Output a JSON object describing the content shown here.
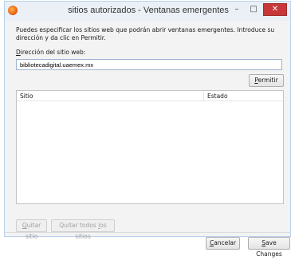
{
  "window": {
    "title": "sitios autorizados - Ventanas emergentes",
    "controls": {
      "minimize": "–",
      "maximize": "□",
      "close": "✕"
    }
  },
  "description": "Puedes especificar los sitios web que podrán abrir ventanas emergentes. Introduce su dirección y da clic en Permitir.",
  "url_field": {
    "label": "Dirección del sitio web:",
    "value": "bibliotecadigital.uaemex.mx"
  },
  "buttons": {
    "permit": "Permitir",
    "remove_site": "Quitar sitio",
    "remove_all": "Quitar todos los sitios",
    "cancel": "Cancelar",
    "save": "Save Changes"
  },
  "list": {
    "columns": [
      "Sitio",
      "Estado"
    ],
    "rows": []
  }
}
